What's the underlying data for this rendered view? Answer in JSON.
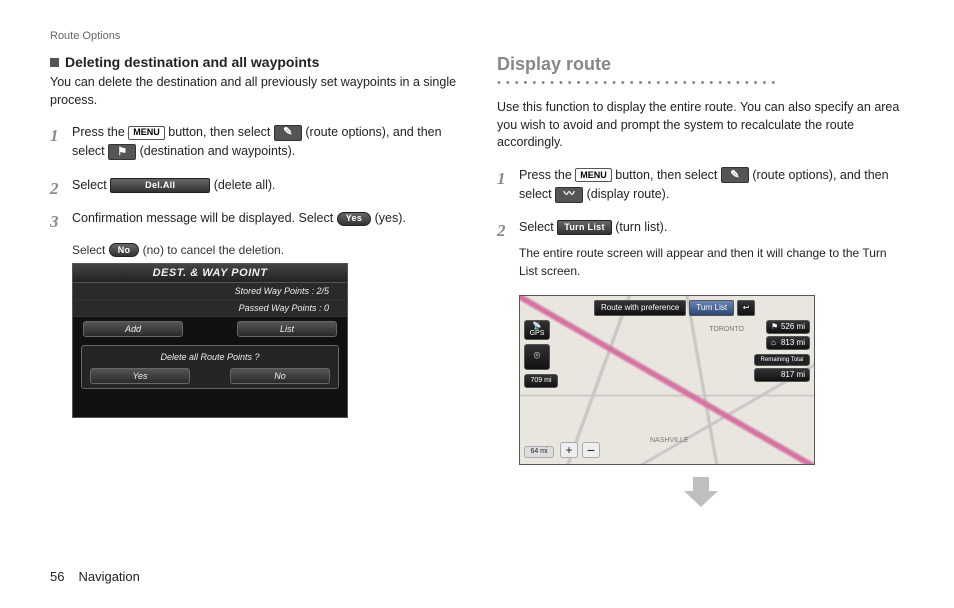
{
  "header": {
    "breadcrumb": "Route Options"
  },
  "left": {
    "heading": "Deleting destination and all waypoints",
    "intro": "You can delete the destination and all previously set waypoints in a single process.",
    "steps": [
      {
        "parts": [
          {
            "t": "Press the "
          },
          {
            "btn": "MENU"
          },
          {
            "t": " button, then select "
          },
          {
            "icon": "pencil"
          },
          {
            "t": " (route options), and then select "
          },
          {
            "icon": "flags"
          },
          {
            "t": " (destination and waypoints)."
          }
        ]
      },
      {
        "parts": [
          {
            "t": "Select "
          },
          {
            "darkwide": "Del.All"
          },
          {
            "t": " (delete all)."
          }
        ]
      },
      {
        "parts": [
          {
            "t": "Confirmation message will be displayed. Select "
          },
          {
            "pill": "Yes"
          },
          {
            "t": " (yes)."
          }
        ],
        "sub": {
          "parts": [
            {
              "t": "Select "
            },
            {
              "pill": "No"
            },
            {
              "t": " (no) to cancel the deletion."
            }
          ]
        }
      }
    ],
    "screen": {
      "title": "DEST. & WAY POINT",
      "row1": "Stored Way Points :  2/5",
      "row2": "Passed Way Points :    0",
      "btnAdd": "Add",
      "btnList": "List",
      "dialogMsg": "Delete all Route Points ?",
      "btnYes": "Yes",
      "btnNo": "No"
    }
  },
  "right": {
    "title": "Display route",
    "intro": "Use this function to display the entire route. You can also specify an area you wish to avoid and prompt the system to recalculate the route accordingly.",
    "steps": [
      {
        "parts": [
          {
            "t": "Press the "
          },
          {
            "btn": "MENU"
          },
          {
            "t": " button, then select "
          },
          {
            "icon": "pencil"
          },
          {
            "t": " (route options), and then select "
          },
          {
            "icon": "route"
          },
          {
            "t": " (display route)."
          }
        ]
      },
      {
        "parts": [
          {
            "t": "Select "
          },
          {
            "dark": "Turn List"
          },
          {
            "t": " (turn list)."
          }
        ],
        "after": "The entire route screen will appear and then it will change to the Turn List screen."
      }
    ],
    "map": {
      "topCenter": "Route with preference",
      "topRight": "Turn List",
      "gps": "GPS",
      "back": "↩",
      "dist1": "526 mi",
      "dist2": "813 mi",
      "distLabel": "Remaining Total",
      "dist3": "817 mi",
      "zoom": "709 mi",
      "scale": "64 mi",
      "plus": "+",
      "minus": "−",
      "city1": "TORONTO",
      "city2": "NASHVILLE"
    }
  },
  "footer": {
    "page": "56",
    "section": "Navigation"
  }
}
